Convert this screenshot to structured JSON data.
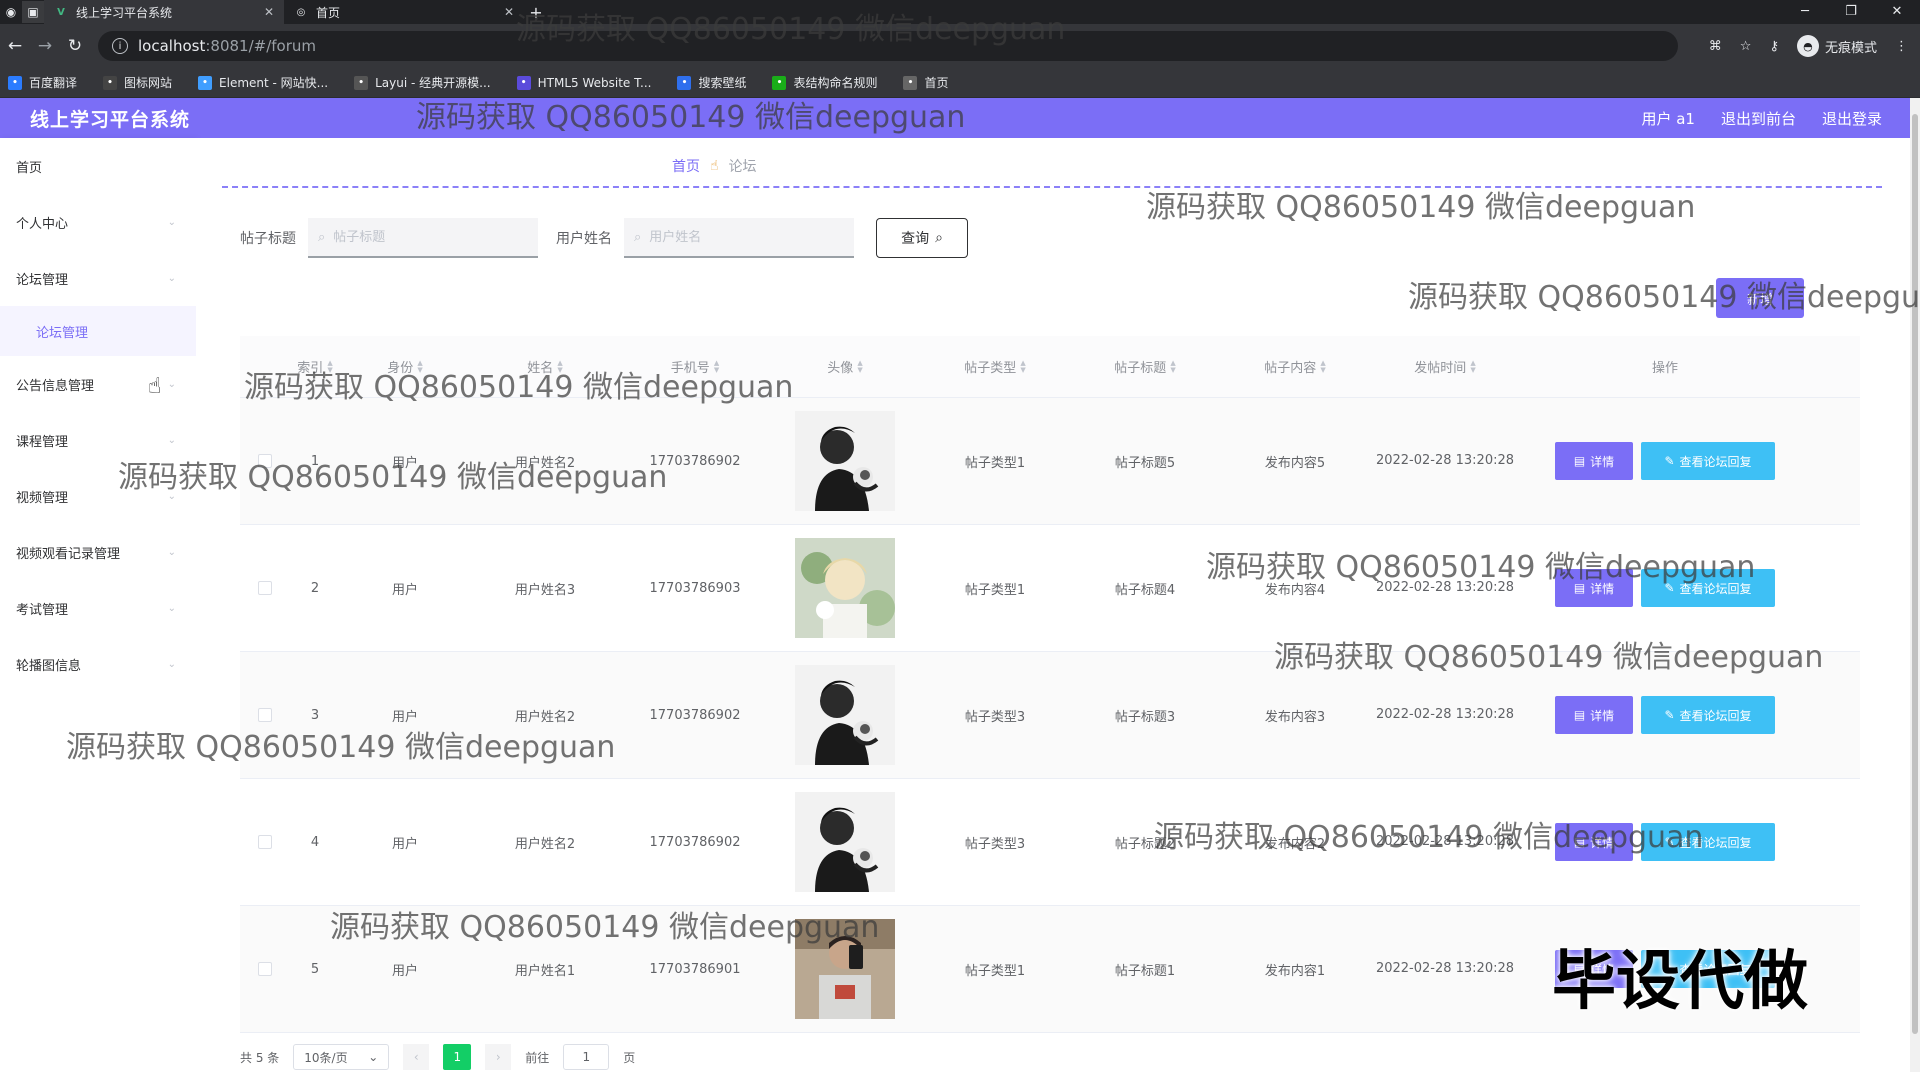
{
  "browser": {
    "tabs": [
      {
        "title": "线上学习平台系统",
        "active": true
      },
      {
        "title": "首页",
        "active": false
      }
    ],
    "new_tab": "+",
    "url_host": "localhost",
    "url_path": ":8081/#/forum",
    "incognito_label": "无痕模式",
    "bookmarks": [
      {
        "label": "百度翻译",
        "color": "#2b7cff"
      },
      {
        "label": "图标网站",
        "color": "#444444"
      },
      {
        "label": "Element - 网站快...",
        "color": "#409eff"
      },
      {
        "label": "Layui - 经典开源模...",
        "color": "#555555"
      },
      {
        "label": "HTML5 Website T...",
        "color": "#5b4bdb"
      },
      {
        "label": "搜索壁纸",
        "color": "#2f6fed"
      },
      {
        "label": "表结构命名规则",
        "color": "#1aad19"
      },
      {
        "label": "首页",
        "color": "#666666"
      }
    ]
  },
  "header": {
    "brand": "线上学习平台系统",
    "user": "用户 a1",
    "back_front": "退出到前台",
    "logout": "退出登录"
  },
  "sidebar": {
    "items": [
      {
        "label": "首页",
        "has_arrow": false
      },
      {
        "label": "个人中心",
        "has_arrow": true
      },
      {
        "label": "论坛管理",
        "has_arrow": true
      },
      {
        "label": "论坛管理",
        "sub": true
      },
      {
        "label": "公告信息管理",
        "has_arrow": true
      },
      {
        "label": "课程管理",
        "has_arrow": true
      },
      {
        "label": "视频管理",
        "has_arrow": true
      },
      {
        "label": "视频观看记录管理",
        "has_arrow": true
      },
      {
        "label": "考试管理",
        "has_arrow": true
      },
      {
        "label": "轮播图信息",
        "has_arrow": true
      }
    ]
  },
  "breadcrumb": {
    "home": "首页",
    "current": "论坛"
  },
  "search": {
    "title_label": "帖子标题",
    "title_placeholder": "帖子标题",
    "user_label": "用户姓名",
    "user_placeholder": "用户姓名",
    "query_button": "查询"
  },
  "add_button": "新增",
  "table": {
    "columns": [
      "索引",
      "身份",
      "姓名",
      "手机号",
      "头像",
      "帖子类型",
      "帖子标题",
      "帖子内容",
      "发帖时间",
      "操作"
    ],
    "rows": [
      {
        "index": "1",
        "role": "用户",
        "name": "用户姓名2",
        "phone": "17703786902",
        "avatar": "dark",
        "type": "帖子类型1",
        "title": "帖子标题5",
        "content": "发布内容5",
        "time": "2022-02-28 13:20:28"
      },
      {
        "index": "2",
        "role": "用户",
        "name": "用户姓名3",
        "phone": "17703786903",
        "avatar": "light",
        "type": "帖子类型1",
        "title": "帖子标题4",
        "content": "发布内容4",
        "time": "2022-02-28 13:20:28"
      },
      {
        "index": "3",
        "role": "用户",
        "name": "用户姓名2",
        "phone": "17703786902",
        "avatar": "dark",
        "type": "帖子类型3",
        "title": "帖子标题3",
        "content": "发布内容3",
        "time": "2022-02-28 13:20:28"
      },
      {
        "index": "4",
        "role": "用户",
        "name": "用户姓名2",
        "phone": "17703786902",
        "avatar": "dark",
        "type": "帖子类型3",
        "title": "帖子标题2",
        "content": "发布内容2",
        "time": "2022-02-28 13:20:28"
      },
      {
        "index": "5",
        "role": "用户",
        "name": "用户姓名1",
        "phone": "17703786901",
        "avatar": "selfie",
        "type": "帖子类型1",
        "title": "帖子标题1",
        "content": "发布内容1",
        "time": "2022-02-28 13:20:28"
      }
    ],
    "detail_label": "详情",
    "reply_label": "查看论坛回复"
  },
  "pagination": {
    "total": "共 5 条",
    "page_size": "10条/页",
    "current_page": "1",
    "goto_prefix": "前往",
    "goto_value": "1",
    "goto_suffix": "页"
  },
  "watermark_text": "源码获取 QQ86050149 微信deepguan",
  "big_watermark": "毕设代做",
  "colors": {
    "accent": "#7b6ef6",
    "reply": "#3ec0f5",
    "page_active": "#13ce66"
  }
}
